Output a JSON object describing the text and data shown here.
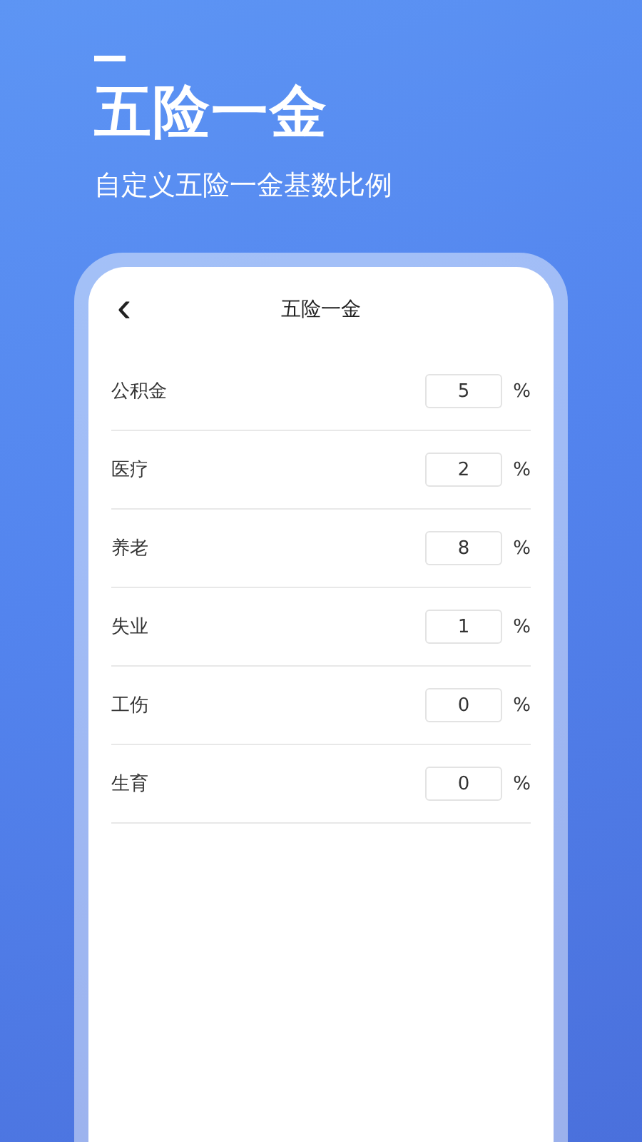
{
  "promo": {
    "title": "五险一金",
    "subtitle": "自定义五险一金基数比例"
  },
  "screen": {
    "title": "五险一金",
    "back": "‹",
    "rows": [
      {
        "label": "公积金",
        "value": "5",
        "unit": "%"
      },
      {
        "label": "医疗",
        "value": "2",
        "unit": "%"
      },
      {
        "label": "养老",
        "value": "8",
        "unit": "%"
      },
      {
        "label": "失业",
        "value": "1",
        "unit": "%"
      },
      {
        "label": "工伤",
        "value": "0",
        "unit": "%"
      },
      {
        "label": "生育",
        "value": "0",
        "unit": "%"
      }
    ]
  }
}
